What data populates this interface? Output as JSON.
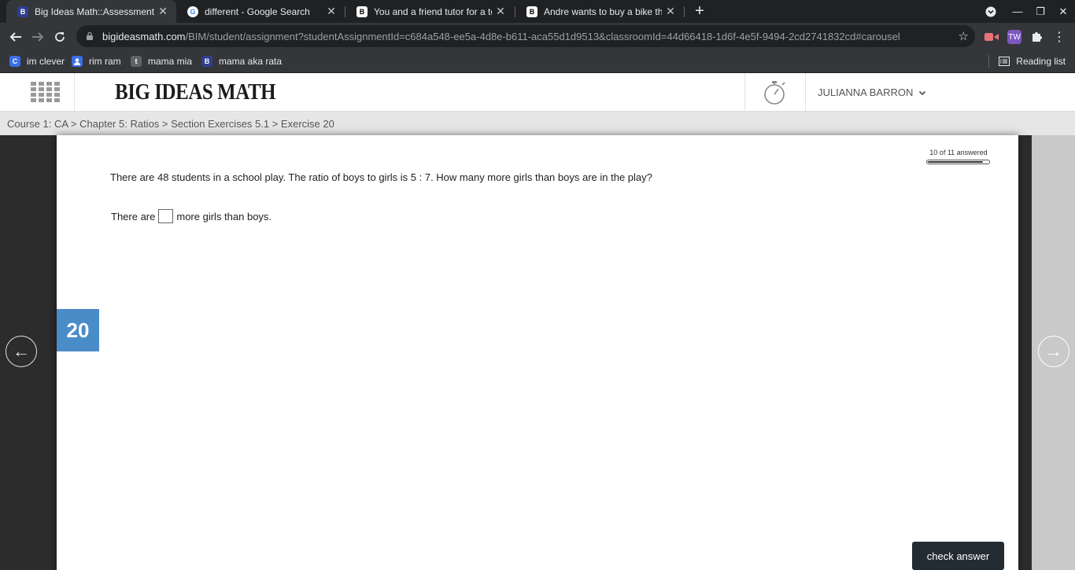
{
  "browser": {
    "tabs": [
      {
        "title": "Big Ideas Math::Assessment",
        "icon": "big-ideas-favicon",
        "active": true
      },
      {
        "title": "different - Google Search",
        "icon": "google-favicon",
        "active": false
      },
      {
        "title": "You and a friend tutor for a tota",
        "icon": "brainly-favicon",
        "active": false
      },
      {
        "title": "Andre wants to buy a bike that h",
        "icon": "brainly-favicon",
        "active": false
      }
    ],
    "url_host": "bigideasmath.com",
    "url_path": "/BIM/student/assignment?studentAssignmentId=c684a548-ee5a-4d8e-b611-aca55d1d9513&classroomId=44d66418-1d6f-4e5f-9494-2cd2741832cd#carousel",
    "bookmarks": [
      {
        "label": "im clever",
        "icon": "clever-icon"
      },
      {
        "label": "rim ram",
        "icon": "profile-icon"
      },
      {
        "label": "mama mia",
        "icon": "tumblr-icon"
      },
      {
        "label": "mama aka rata",
        "icon": "big-ideas-favicon"
      }
    ],
    "reading_list": "Reading list"
  },
  "header": {
    "logo": "BIG IDEAS MATH",
    "user_name": "JULIANNA BARRON"
  },
  "breadcrumb": "Course 1: CA > Chapter 5: Ratios > Section Exercises 5.1 > Exercise 20",
  "progress": {
    "label": "10 of 11 answered",
    "answered": 10,
    "total": 11
  },
  "exercise": {
    "number": "20",
    "question": "There are 48 students in a school play. The ratio of boys to girls is 5 : 7. How many more girls than boys are in the play?",
    "answer_prefix": "There are",
    "answer_suffix": "more girls than boys.",
    "answer_value": ""
  },
  "buttons": {
    "check_answer": "check answer"
  },
  "colors": {
    "exercise_badge": "#4a8cc8",
    "check_button": "#232b33",
    "chrome_dark": "#202124",
    "chrome_toolbar": "#35363a"
  }
}
